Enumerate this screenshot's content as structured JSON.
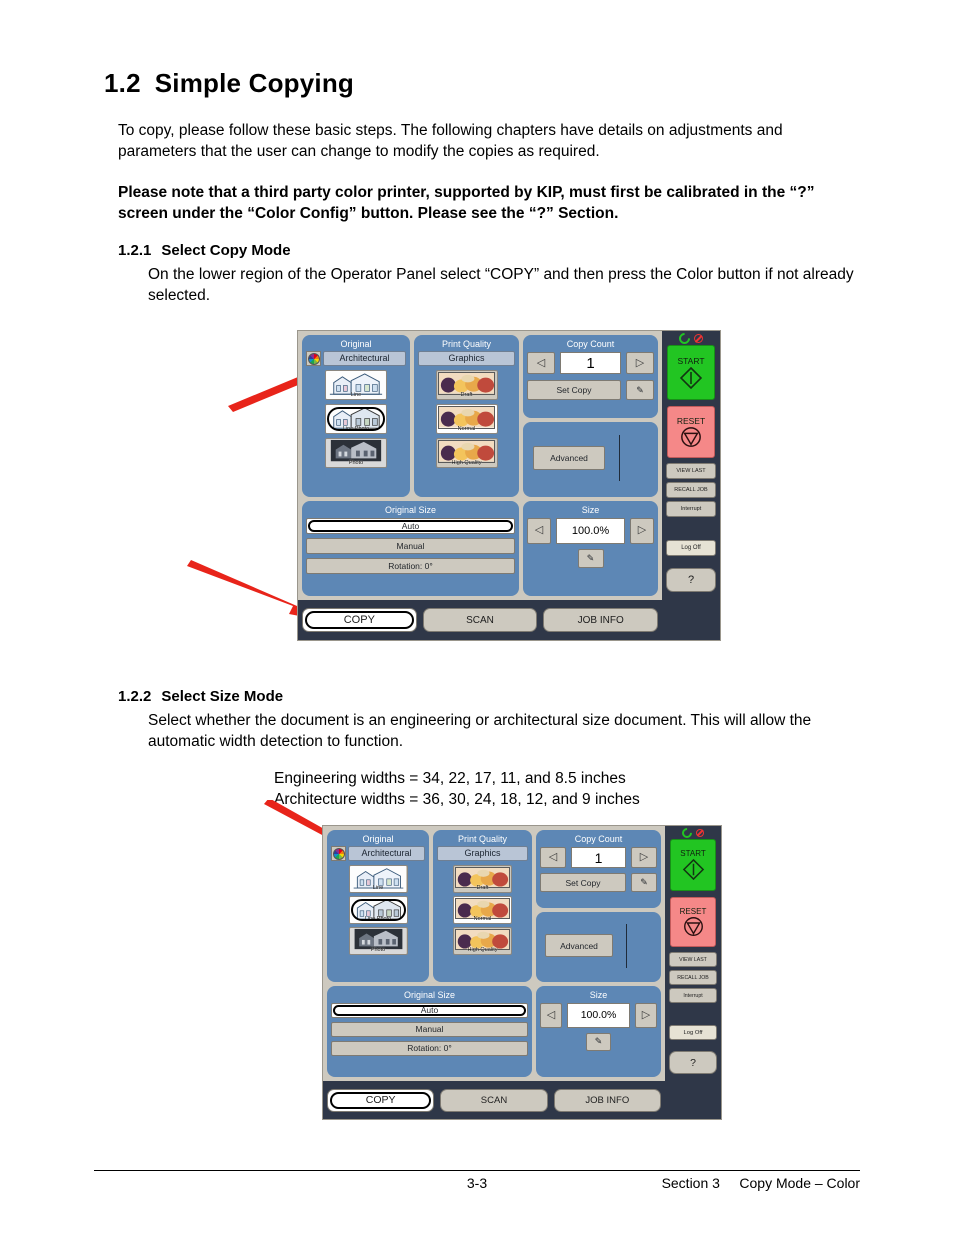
{
  "document": {
    "heading_number": "1.2",
    "heading_title": "Simple Copying",
    "intro": "To copy, please follow these basic steps. The following chapters have details on adjustments and parameters that the user can change to modify the copies as required.",
    "note": "Please note that a third party color printer, supported by KIP, must first be calibrated in the “?” screen under the “Color Config” button. Please see the “?” Section.",
    "section_121_number": "1.2.1",
    "section_121_title": "Select Copy Mode",
    "section_121_body": "On the lower region of the Operator Panel select “COPY” and then press the Color button if not already selected.",
    "section_122_number": "1.2.2",
    "section_122_title": "Select Size Mode",
    "section_122_body": "Select whether the document is an engineering or architectural size document. This will allow the automatic width detection to function.",
    "widths_engineering": "Engineering widths = 34, 22, 17, 11, and 8.5 inches",
    "widths_architecture": "Architecture widths = 36, 30, 24, 18, 12, and 9 inches",
    "footer_page": "3-3",
    "footer_section": "Section 3     Copy Mode – Color"
  },
  "panel": {
    "original": {
      "title": "Original",
      "mode_label": "Architectural",
      "color_icon": "color-wheel-icon",
      "options": [
        {
          "label": "Line",
          "selected": false
        },
        {
          "label": "Line Photo",
          "selected": true
        },
        {
          "label": "Photo",
          "selected": false
        }
      ]
    },
    "print_quality": {
      "title": "Print Quality",
      "mode_label": "Graphics",
      "options": [
        {
          "label": "Draft",
          "selected": false
        },
        {
          "label": "Normal",
          "selected": true
        },
        {
          "label": "High Quality",
          "selected": false
        }
      ]
    },
    "copy_count": {
      "title": "Copy Count",
      "value": "1",
      "decrement_icon": "triangle-left-icon",
      "increment_icon": "triangle-right-icon",
      "set_copy_label": "Set Copy",
      "edit_icon": "pencil-icon"
    },
    "advanced": {
      "label": "Advanced"
    },
    "original_size": {
      "title": "Original Size",
      "options": [
        {
          "label": "Auto",
          "selected": true
        },
        {
          "label": "Manual",
          "selected": false
        },
        {
          "label": "Rotation: 0°",
          "selected": false
        }
      ]
    },
    "size": {
      "title": "Size",
      "value": "100.0%",
      "decrement_icon": "triangle-left-icon",
      "increment_icon": "triangle-right-icon",
      "edit_icon": "pencil-icon"
    },
    "sidebar": {
      "led_ready_icon": "ready-led-icon",
      "led_error_icon": "error-led-icon",
      "start_label": "START",
      "start_icon": "start-diamond-icon",
      "reset_label": "RESET",
      "reset_icon": "reset-stop-icon",
      "buttons": [
        {
          "label": "VIEW LAST"
        },
        {
          "label": "RECALL JOB"
        },
        {
          "label": "Interrupt"
        }
      ],
      "log_off_label": "Log Off",
      "help_label": "?"
    },
    "nav": [
      {
        "label": "COPY",
        "selected": true
      },
      {
        "label": "SCAN",
        "selected": false
      },
      {
        "label": "JOB INFO",
        "selected": false
      }
    ]
  },
  "colors": {
    "panel_bg": "#cdc9bf",
    "group_blue": "#5d87b5",
    "sidebar_dark": "#2f3748",
    "start_green": "#22c522",
    "reset_red": "#f58888",
    "arrow_red": "#e8241a"
  }
}
